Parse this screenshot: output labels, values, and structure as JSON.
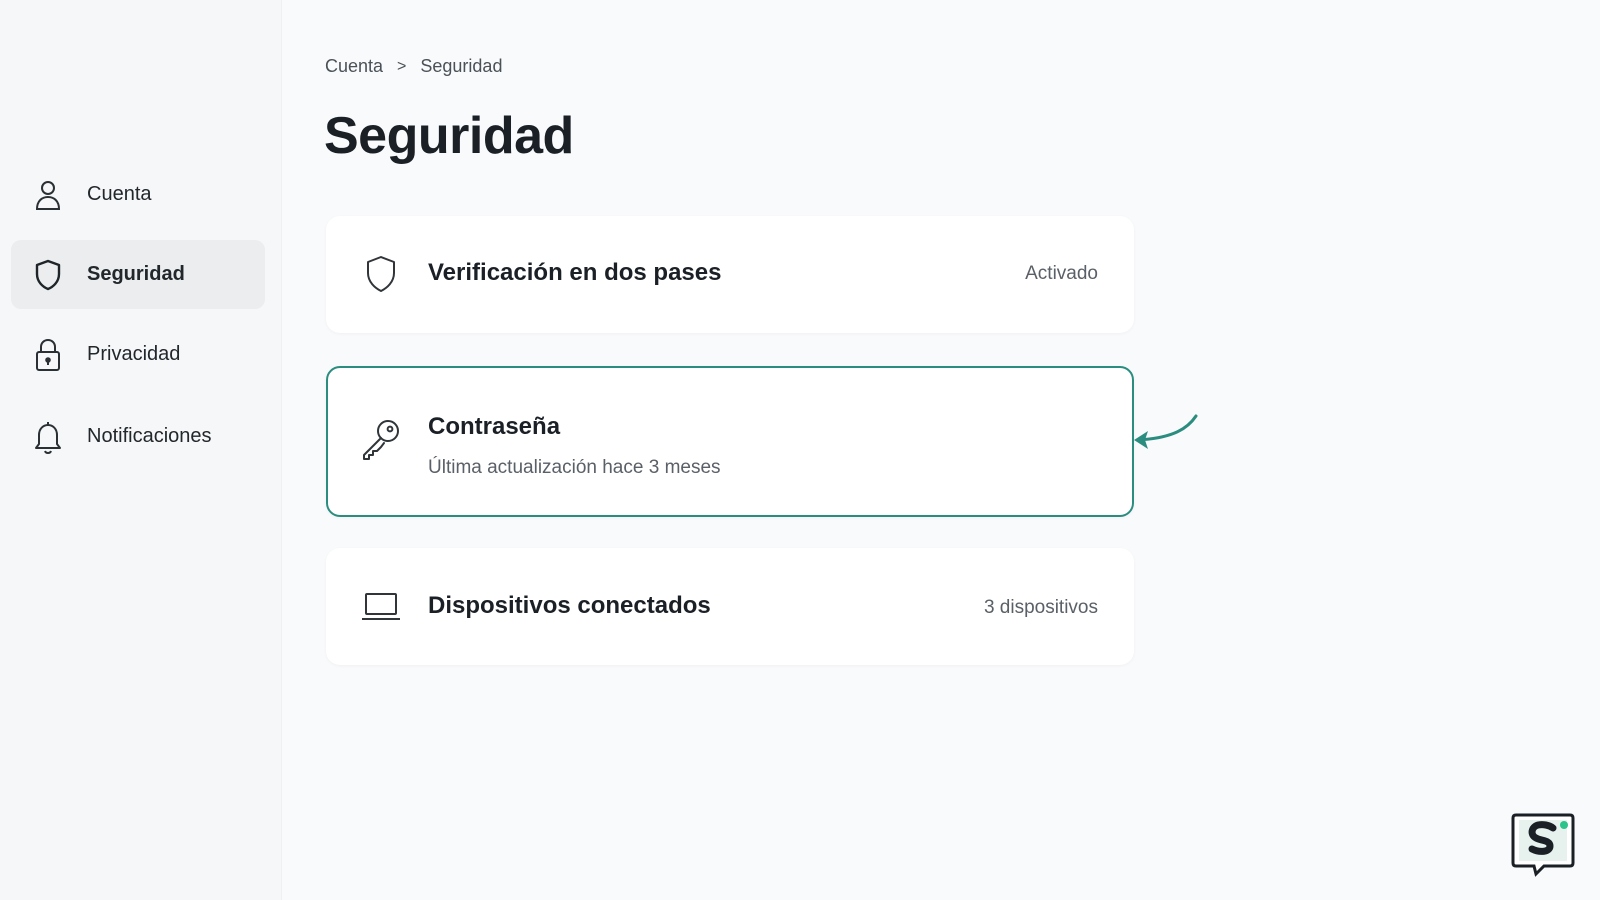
{
  "sidebar": {
    "items": [
      {
        "label": "Cuenta",
        "icon": "user-icon"
      },
      {
        "label": "Seguridad",
        "icon": "shield-icon",
        "active": true
      },
      {
        "label": "Privacidad",
        "icon": "lock-icon"
      },
      {
        "label": "Notificaciones",
        "icon": "bell-icon"
      }
    ]
  },
  "breadcrumb": {
    "parent": "Cuenta",
    "separator": ">",
    "current": "Seguridad"
  },
  "page": {
    "title": "Seguridad"
  },
  "cards": {
    "two_factor": {
      "title": "Verificación en dos pases",
      "status": "Activado",
      "icon": "shield-icon"
    },
    "password": {
      "title": "Contraseña",
      "subtitle": "Última actualización hace 3 meses",
      "icon": "key-icon"
    },
    "devices": {
      "title": "Dispositivos conectados",
      "status": "3 dispositivos",
      "icon": "laptop-icon"
    }
  },
  "colors": {
    "accent": "#2a8d7f",
    "active_nav_bg": "#ebedef",
    "page_bg": "#f9fafb"
  }
}
